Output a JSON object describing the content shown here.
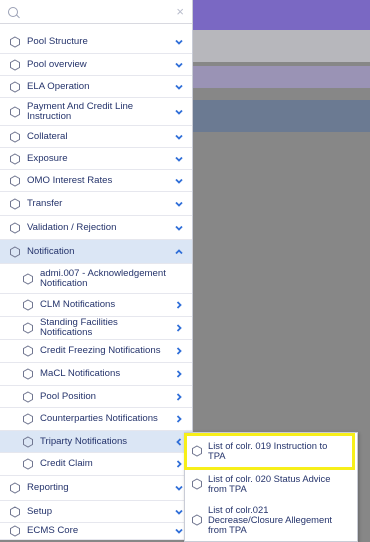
{
  "search": {
    "placeholder": "",
    "value": ""
  },
  "menu": {
    "items": [
      {
        "label": "Pool Structure",
        "icon": "hexagon-icon",
        "chevron": "down"
      },
      {
        "label": "Pool overview",
        "icon": "hexagon-icon",
        "chevron": "down"
      },
      {
        "label": "ELA Operation",
        "icon": "hexagon-icon",
        "chevron": "down"
      },
      {
        "label": "Payment And Credit Line Instruction",
        "icon": "hexagon-icon",
        "chevron": "down"
      },
      {
        "label": "Collateral",
        "icon": "hexagon-icon",
        "chevron": "down"
      },
      {
        "label": "Exposure",
        "icon": "hexagon-icon",
        "chevron": "down"
      },
      {
        "label": "OMO Interest Rates",
        "icon": "hexagon-icon",
        "chevron": "down"
      },
      {
        "label": "Transfer",
        "icon": "hexagon-icon",
        "chevron": "down"
      },
      {
        "label": "Validation / Rejection",
        "icon": "hexagon-icon",
        "chevron": "down"
      },
      {
        "label": "Notification",
        "icon": "hexagon-icon",
        "chevron": "up"
      },
      {
        "label": "admi.007 - Acknowledgement Notification",
        "icon": "hexagon-icon",
        "chevron": "none"
      },
      {
        "label": "CLM Notifications",
        "icon": "hexagon-icon",
        "chevron": "right"
      },
      {
        "label": "Standing Facilities Notifications",
        "icon": "hexagon-icon",
        "chevron": "right"
      },
      {
        "label": "Credit Freezing Notifications",
        "icon": "hexagon-icon",
        "chevron": "right"
      },
      {
        "label": "MaCL Notifications",
        "icon": "hexagon-icon",
        "chevron": "right"
      },
      {
        "label": "Pool Position",
        "icon": "hexagon-icon",
        "chevron": "right"
      },
      {
        "label": "Counterparties Notifications",
        "icon": "hexagon-icon",
        "chevron": "right"
      },
      {
        "label": "Triparty Notifications",
        "icon": "hexagon-icon",
        "chevron": "left"
      },
      {
        "label": "Credit Claim",
        "icon": "hexagon-icon",
        "chevron": "right"
      },
      {
        "label": "Reporting",
        "icon": "hexagon-icon",
        "chevron": "down"
      },
      {
        "label": "Setup",
        "icon": "hexagon-icon",
        "chevron": "down"
      },
      {
        "label": "ECMS Core",
        "icon": "hexagon-icon",
        "chevron": "down"
      }
    ]
  },
  "flyout": {
    "items": [
      {
        "label": "List of colr. 019 Instruction to TPA",
        "icon": "hexagon-icon"
      },
      {
        "label": "List of colr. 020 Status Advice from TPA",
        "icon": "hexagon-icon"
      },
      {
        "label": "List of colr.021 Decrease/Closure Allegement from TPA",
        "icon": "hexagon-icon"
      }
    ]
  },
  "colors": {
    "accent_chevron": "#2f6ed8",
    "highlight": "#f7ef19",
    "active_bg": "#dbe6f5",
    "topbar": "#7a68c3"
  }
}
